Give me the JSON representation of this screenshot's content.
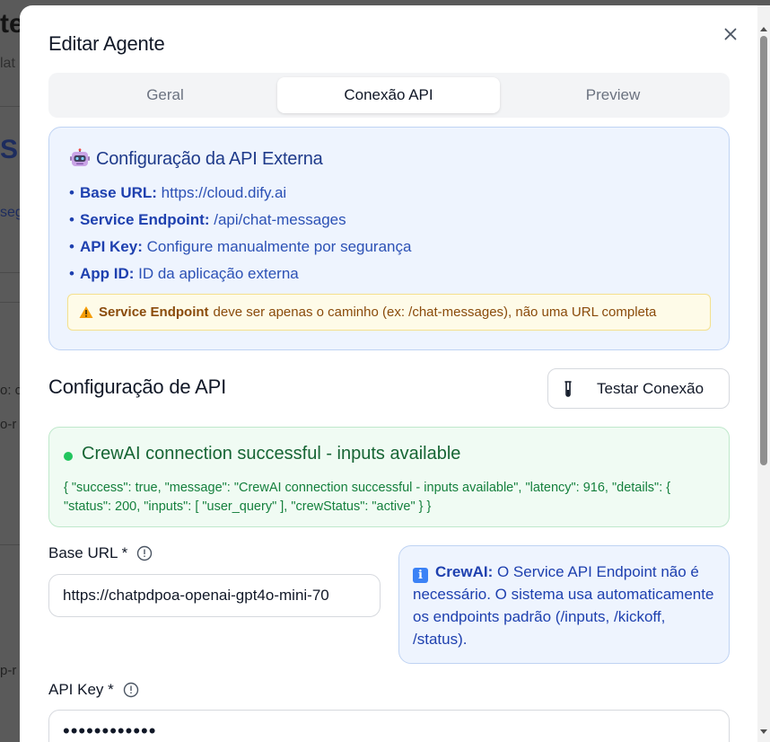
{
  "background": {
    "frag_big": "te",
    "frag_sub": "lat",
    "frag_title2": "S",
    "frag_link": "seg",
    "frag_l1": "o: c",
    "frag_l2": "o-r",
    "frag_l3": "p-r"
  },
  "modal": {
    "title": "Editar Agente",
    "close_icon": "close-icon"
  },
  "tabs": [
    {
      "label": "Geral",
      "active": false
    },
    {
      "label": "Conexão API",
      "active": true
    },
    {
      "label": "Preview",
      "active": false
    }
  ],
  "info_panel": {
    "icon": "robot-icon",
    "title": "Configuração da API Externa",
    "items": [
      {
        "label": "Base URL:",
        "value": "https://cloud.dify.ai"
      },
      {
        "label": "Service Endpoint:",
        "value": "/api/chat-messages"
      },
      {
        "label": "API Key:",
        "value": "Configure manualmente por segurança"
      },
      {
        "label": "App ID:",
        "value": "ID da aplicação externa"
      }
    ],
    "warning": {
      "icon": "warning-icon",
      "bold": "Service Endpoint",
      "text": "deve ser apenas o caminho (ex: /chat-messages), não uma URL completa"
    }
  },
  "section": {
    "title": "Configuração de API",
    "test_button": {
      "icon": "test-tube-icon",
      "label": "Testar Conexão"
    }
  },
  "success": {
    "title": "CrewAI connection successful - inputs available",
    "json": "{ \"success\": true, \"message\": \"CrewAI connection successful - inputs available\", \"latency\": 916, \"details\": { \"status\": 200, \"inputs\": [ \"user_query\" ], \"crewStatus\": \"active\" } }"
  },
  "fields": {
    "base_url": {
      "label": "Base URL *",
      "value": "https://chatpdpoa-openai-gpt4o-mini-70"
    },
    "api_key": {
      "label": "API Key *",
      "value": "••••••••••••"
    }
  },
  "crew_note": {
    "icon": "info-icon",
    "bold": "CrewAI:",
    "text": "O Service API Endpoint não é necessário. O sistema usa automaticamente os endpoints padrão (/inputs, /kickoff, /status)."
  },
  "colors": {
    "accent_blue": "#1e40af",
    "success_green": "#166534",
    "warning_brown": "#8a4b0b"
  }
}
